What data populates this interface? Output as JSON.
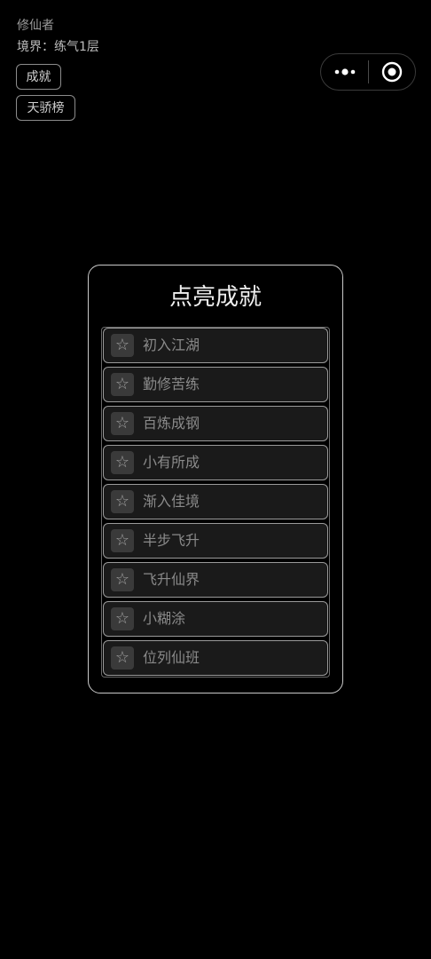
{
  "player": {
    "name": "修仙者",
    "realm_label": "境界：",
    "realm_value": "练气1层"
  },
  "buttons": {
    "achievements": "成就",
    "rankings": "天骄榜"
  },
  "capsule": {
    "more_icon": "more-dots-icon",
    "close_icon": "target-circle-icon"
  },
  "modal": {
    "title": "点亮成就",
    "items": [
      {
        "icon": "star-outline-icon",
        "label": "初入江湖"
      },
      {
        "icon": "star-outline-icon",
        "label": "勤修苦练"
      },
      {
        "icon": "star-outline-icon",
        "label": "百炼成钢"
      },
      {
        "icon": "star-outline-icon",
        "label": "小有所成"
      },
      {
        "icon": "star-outline-icon",
        "label": "渐入佳境"
      },
      {
        "icon": "star-outline-icon",
        "label": "半步飞升"
      },
      {
        "icon": "star-outline-icon",
        "label": "飞升仙界"
      },
      {
        "icon": "star-outline-icon",
        "label": "小糊涂"
      },
      {
        "icon": "star-outline-icon",
        "label": "位列仙班"
      }
    ]
  },
  "colors": {
    "background": "#000000",
    "item_bg": "#1a1a1a",
    "item_text": "#8a8a8a",
    "border": "#c9c9c9"
  }
}
